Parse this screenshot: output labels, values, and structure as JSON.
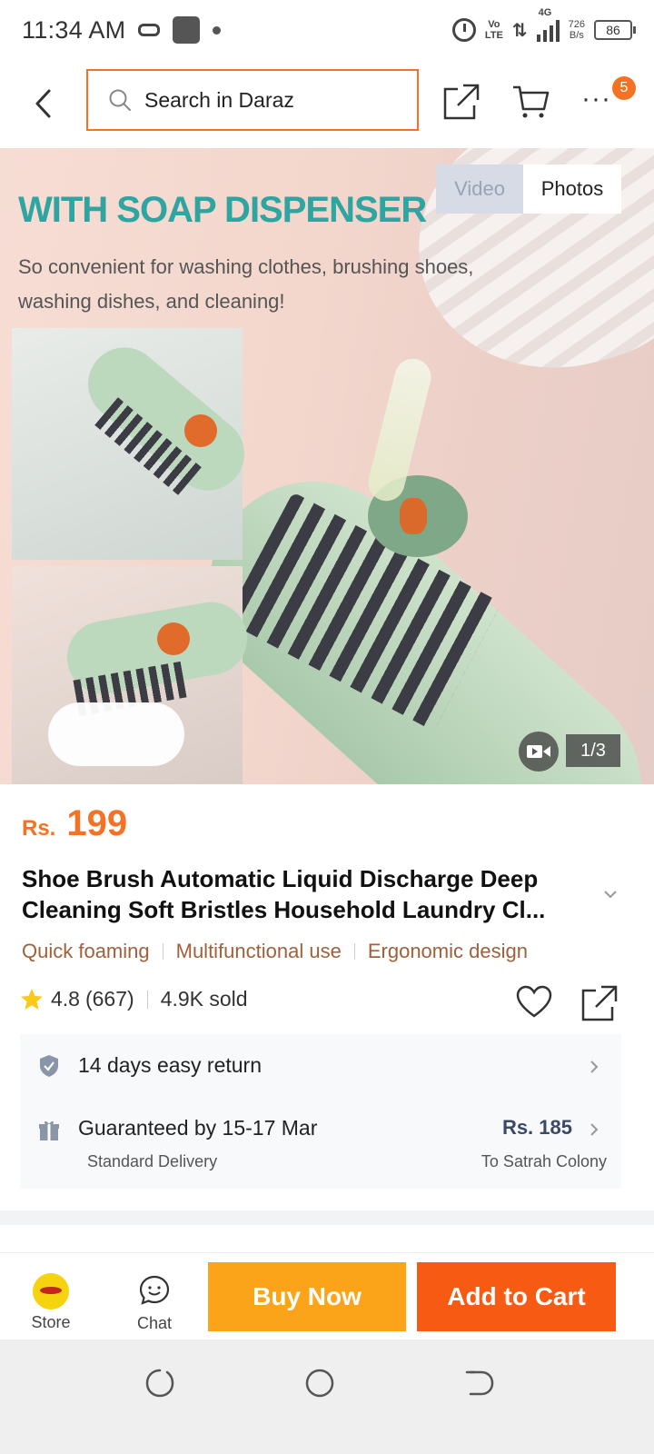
{
  "status_bar": {
    "time": "11:34 AM",
    "volte_line1": "Vo",
    "volte_line2": "LTE",
    "network": "4G",
    "speed_value": "726",
    "speed_unit": "B/s",
    "battery": "86"
  },
  "top_nav": {
    "search_placeholder": "Search in Daraz",
    "cart_badge": "5",
    "more_label": "···"
  },
  "gallery": {
    "headline": "WITH SOAP DISPENSER",
    "subline": "So convenient for washing clothes, brushing shoes, washing dishes, and cleaning!",
    "tab_video": "Video",
    "tab_photos": "Photos",
    "selected_tab": "Photos",
    "counter": "1/3"
  },
  "product": {
    "currency": "Rs.",
    "price": "199",
    "title": "Shoe Brush Automatic Liquid Discharge Deep Cleaning Soft Bristles Household Laundry Cl...",
    "tags": [
      "Quick foaming",
      "Multifunctional use",
      "Ergonomic design"
    ],
    "rating": "4.8",
    "review_count": "(667)",
    "sold": "4.9K sold"
  },
  "services": {
    "return_policy": "14 days easy return",
    "delivery_guarantee": "Guaranteed by 15-17 Mar",
    "delivery_type": "Standard Delivery",
    "delivery_fee": "Rs. 185",
    "delivery_destination": "To Satrah Colony"
  },
  "bottom_bar": {
    "store_label": "Store",
    "chat_label": "Chat",
    "buy_now_label": "Buy Now",
    "add_to_cart_label": "Add to Cart"
  },
  "colors": {
    "brand_orange": "#f57224",
    "buy_now": "#fca419",
    "add_to_cart": "#f65a13",
    "tag_text": "#a0603a"
  },
  "icons": [
    "back-arrow-icon",
    "search-icon",
    "share-icon",
    "cart-icon",
    "more-icon",
    "video-camera-icon",
    "chevron-down-icon",
    "star-icon",
    "heart-icon",
    "shield-icon",
    "gift-box-icon",
    "chevron-right-icon",
    "store-logo-icon",
    "chat-icon",
    "recents-icon",
    "home-icon",
    "back-nav-icon"
  ]
}
